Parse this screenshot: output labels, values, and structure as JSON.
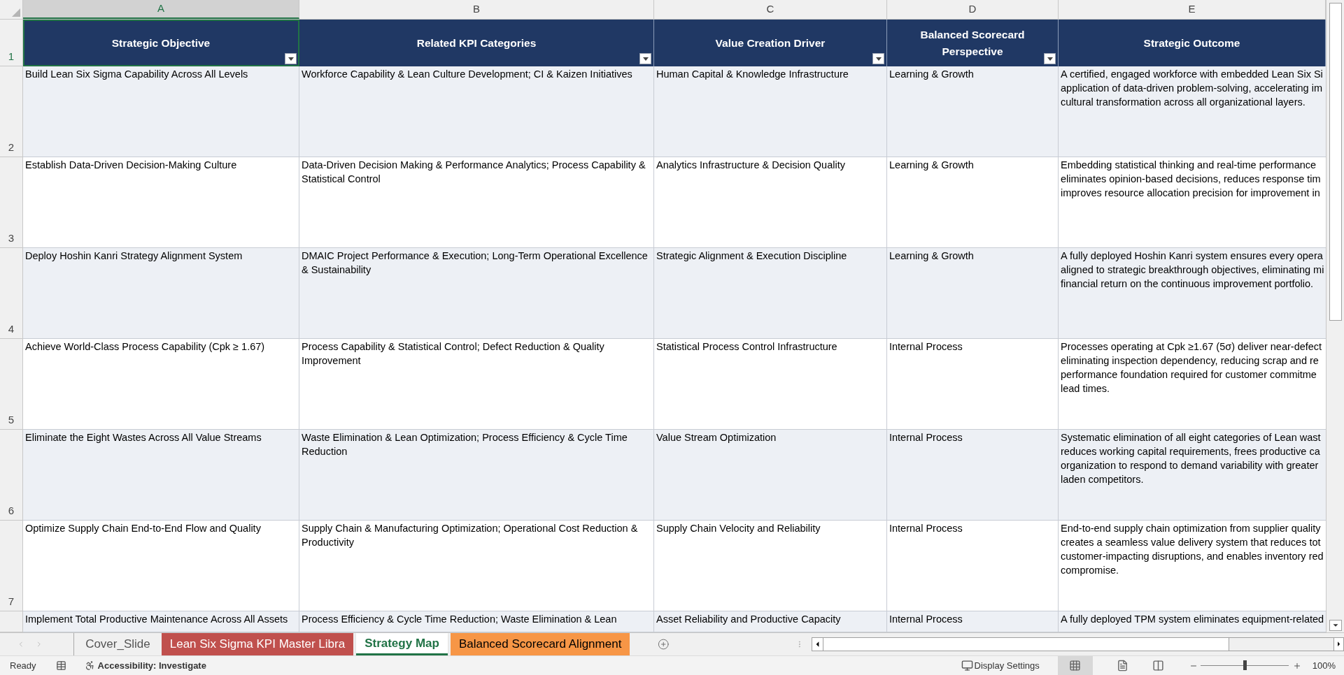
{
  "columns": [
    {
      "letter": "A",
      "selected": true
    },
    {
      "letter": "B",
      "selected": false
    },
    {
      "letter": "C",
      "selected": false
    },
    {
      "letter": "D",
      "selected": false
    },
    {
      "letter": "E",
      "selected": false
    }
  ],
  "header": {
    "row_number": "1",
    "cells": [
      "Strategic Objective",
      "Related KPI Categories",
      "Value Creation Driver",
      "Balanced Scorecard Perspective",
      "Strategic Outcome"
    ]
  },
  "rows": [
    {
      "number": "2",
      "cells": [
        "Build Lean Six Sigma Capability Across All Levels",
        "Workforce Capability & Lean Culture Development; CI & Kaizen Initiatives",
        "Human Capital & Knowledge Infrastructure",
        "Learning & Growth"
      ],
      "outcome_lines": [
        "A certified, engaged workforce with embedded Lean Six Si",
        "application of data-driven problem-solving, accelerating im",
        "cultural transformation across all organizational layers."
      ]
    },
    {
      "number": "3",
      "cells": [
        "Establish Data-Driven Decision-Making Culture",
        "Data-Driven Decision Making & Performance Analytics; Process Capability & Statistical Control",
        "Analytics Infrastructure & Decision Quality",
        "Learning & Growth"
      ],
      "outcome_lines": [
        "Embedding statistical thinking and real-time performance",
        "eliminates opinion-based decisions, reduces response tim",
        "improves resource allocation precision for improvement in"
      ]
    },
    {
      "number": "4",
      "cells": [
        "Deploy Hoshin Kanri Strategy Alignment System",
        "DMAIC Project Performance & Execution; Long-Term Operational Excellence & Sustainability",
        "Strategic Alignment & Execution Discipline",
        "Learning & Growth"
      ],
      "outcome_lines": [
        "A fully deployed Hoshin Kanri system ensures every opera",
        "aligned to strategic breakthrough objectives, eliminating mi",
        "financial return on the continuous improvement portfolio."
      ]
    },
    {
      "number": "5",
      "cells": [
        "Achieve World-Class Process Capability (Cpk ≥ 1.67)",
        "Process Capability & Statistical Control; Defect Reduction & Quality Improvement",
        "Statistical Process Control Infrastructure",
        "Internal Process"
      ],
      "outcome_lines": [
        "Processes operating at Cpk ≥1.67 (5σ) deliver near-defect",
        "eliminating inspection dependency, reducing scrap and re",
        "performance foundation required for customer commitme",
        "lead times."
      ]
    },
    {
      "number": "6",
      "cells": [
        "Eliminate the Eight Wastes Across All Value Streams",
        "Waste Elimination & Lean Optimization; Process Efficiency & Cycle Time Reduction",
        "Value Stream Optimization",
        "Internal Process"
      ],
      "outcome_lines": [
        "Systematic elimination of all eight categories of Lean wast",
        "reduces working capital requirements, frees productive ca",
        "organization to respond to demand variability with greater",
        "laden competitors."
      ]
    },
    {
      "number": "7",
      "cells": [
        "Optimize Supply Chain End-to-End Flow and Quality",
        "Supply Chain & Manufacturing Optimization; Operational Cost Reduction & Productivity",
        "Supply Chain Velocity and Reliability",
        "Internal Process"
      ],
      "outcome_lines": [
        "End-to-end supply chain optimization from supplier quality",
        "creates a seamless value delivery system that reduces tot",
        "customer-impacting disruptions, and enables inventory red",
        "compromise."
      ]
    },
    {
      "cells": [
        "Implement Total Productive Maintenance Across All Assets",
        "Process Efficiency & Cycle Time Reduction; Waste Elimination & Lean",
        "Asset Reliability and Productive Capacity",
        "Internal Process"
      ],
      "outcome_lines": [
        "A fully deployed TPM system eliminates equipment-related"
      ]
    }
  ],
  "sheet_tabs": [
    {
      "label": "Cover_Slide",
      "selected": false
    },
    {
      "label": "Lean Six Sigma KPI Master Libra",
      "selected": false,
      "color": "#c0504d"
    },
    {
      "label": "Strategy Map",
      "selected": true
    },
    {
      "label": "Balanced Scorecard Alignment",
      "selected": false,
      "color": "#f79646"
    }
  ],
  "status_bar": {
    "mode": "Ready",
    "accessibility": "Accessibility: Investigate",
    "display_settings": "Display Settings",
    "zoom": {
      "level": 0.5,
      "reading": "100%"
    }
  }
}
